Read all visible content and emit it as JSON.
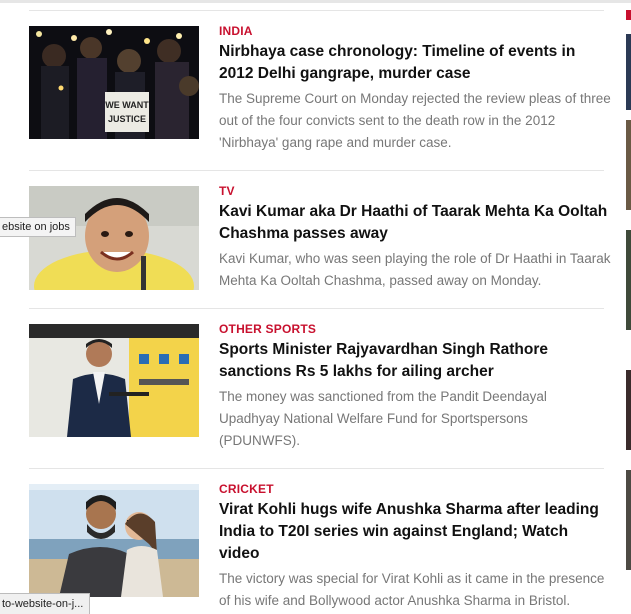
{
  "articles": [
    {
      "category": "INDIA",
      "headline": "Nirbhaya case chronology: Timeline of events in 2012 Delhi gangrape, murder case",
      "summary": "The Supreme Court on Monday rejected the review pleas of three out of the four convicts sent to the death row in the 2012 'Nirbhaya' gang rape and murder case.",
      "sign_text": "WE WANT JUSTICE"
    },
    {
      "category": "TV",
      "headline": "Kavi Kumar aka Dr Haathi of Taarak Mehta Ka Ooltah Chashma passes away",
      "summary": "Kavi Kumar, who was seen playing the role of Dr Haathi in Taarak Mehta Ka Ooltah Chashma, passed away on Monday."
    },
    {
      "category": "OTHER SPORTS",
      "headline": "Sports Minister Rajyavardhan Singh Rathore sanctions Rs 5 lakhs for ailing archer",
      "summary": "The money was sanctioned from the Pandit Deendayal Upadhyay National Welfare Fund for Sportspersons (PDUNWFS)."
    },
    {
      "category": "CRICKET",
      "headline": "Virat Kohli hugs wife Anushka Sharma after leading India to T20I series win against England; Watch video",
      "summary": "The victory was special for Virat Kohli as it came in the presence of his wife and Bollywood actor Anushka Sharma in Bristol."
    }
  ],
  "tooltip_text": "ebsite on jobs",
  "status_url": "to-website-on-j...",
  "colors": {
    "category": "#c8102e",
    "headline": "#111111",
    "summary": "#777777",
    "divider": "#e5e5e5"
  }
}
